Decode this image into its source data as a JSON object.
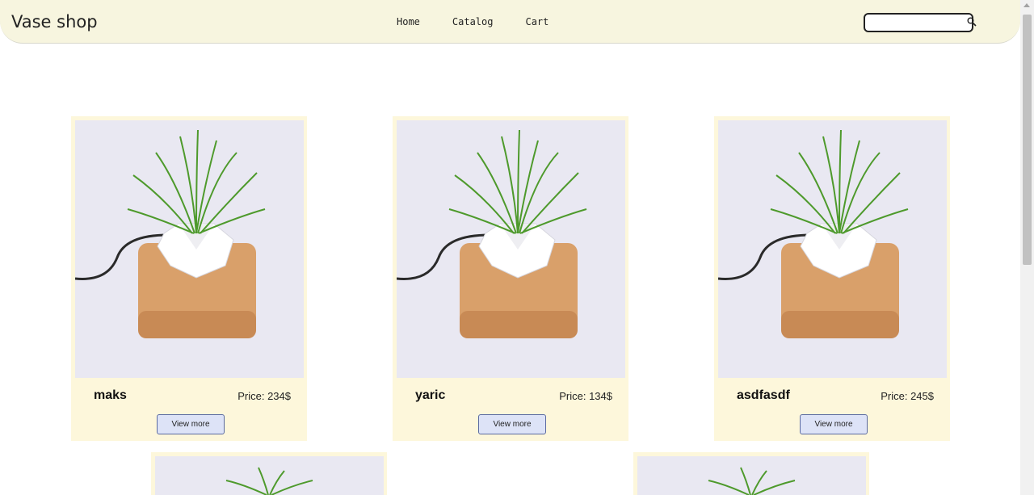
{
  "header": {
    "logo": "Vase shop",
    "nav": [
      "Home",
      "Catalog",
      "Cart"
    ],
    "search_placeholder": ""
  },
  "products": [
    {
      "name": "maks",
      "price": "Price: 234$",
      "button": "View more"
    },
    {
      "name": "yaric",
      "price": "Price: 134$",
      "button": "View more"
    },
    {
      "name": "asdfasdf",
      "price": "Price: 245$",
      "button": "View more"
    }
  ],
  "colors": {
    "header_bg": "#f7f5df",
    "card_bg": "#fdf7db",
    "button_bg": "#dde3f7",
    "photo_bg": "#e9e8f2",
    "base_wood": "#d9a06a",
    "grass": "#4e9a2c"
  }
}
